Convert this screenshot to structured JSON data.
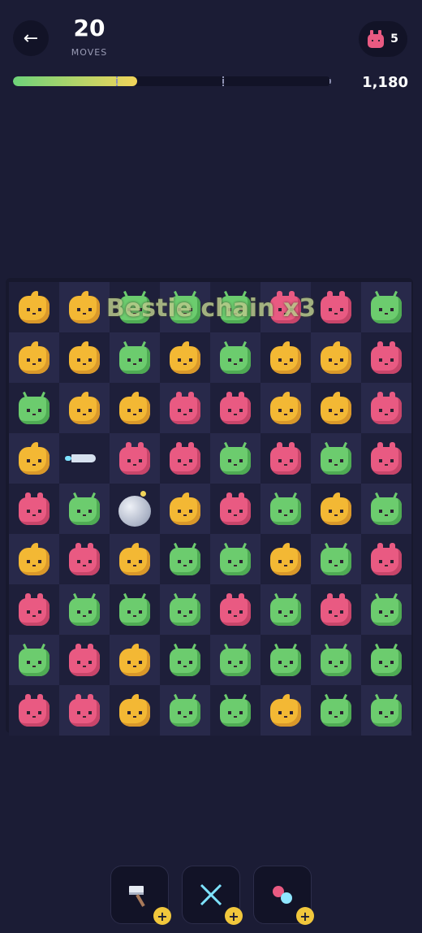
{
  "header": {
    "back_label": "←",
    "moves_value": "20",
    "moves_label": "MOVES",
    "target_count": "5",
    "score": "1,180",
    "progress_fraction": 0.39
  },
  "board": {
    "rows": [
      [
        "yellow",
        "yellow",
        "green",
        "green",
        "green",
        "pink",
        "pink",
        "green"
      ],
      [
        "yellow",
        "yellow",
        "green",
        "yellow",
        "green",
        "yellow",
        "yellow",
        "pink"
      ],
      [
        "green",
        "yellow",
        "yellow",
        "pink",
        "pink",
        "yellow",
        "yellow",
        "pink"
      ],
      [
        "yellow",
        "rocket",
        "pink",
        "pink",
        "green",
        "pink",
        "green",
        "pink"
      ],
      [
        "pink",
        "green",
        "bomb",
        "yellow",
        "pink",
        "green",
        "yellow",
        "green"
      ],
      [
        "yellow",
        "pink",
        "yellow",
        "green",
        "green",
        "yellow",
        "green",
        "pink"
      ],
      [
        "pink",
        "green",
        "green",
        "green",
        "pink",
        "green",
        "pink",
        "green"
      ],
      [
        "green",
        "pink",
        "yellow",
        "green",
        "green",
        "green",
        "green",
        "green"
      ],
      [
        "pink",
        "pink",
        "yellow",
        "green",
        "green",
        "yellow",
        "green",
        "green"
      ]
    ],
    "chain_text": "Bestie chain x3"
  },
  "tools": [
    {
      "name": "hammer",
      "plus": "+"
    },
    {
      "name": "cross-swap",
      "plus": "+"
    },
    {
      "name": "color-swap",
      "plus": "+"
    }
  ],
  "colors": {
    "background": "#1b1c35",
    "yellow": "#f3b834",
    "pink": "#e95a82",
    "green": "#6ccc6e",
    "accent": "#f1c73c"
  }
}
